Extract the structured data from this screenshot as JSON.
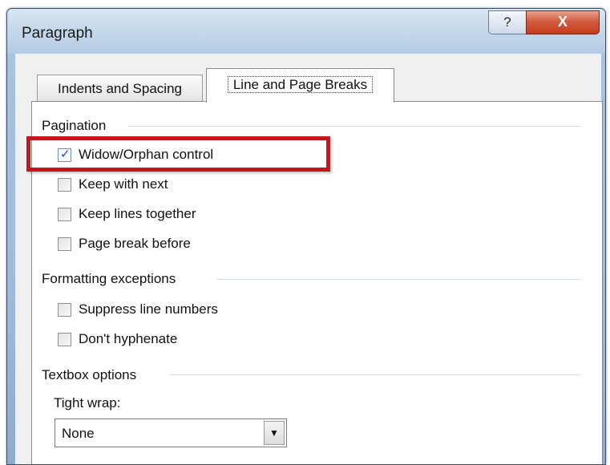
{
  "window": {
    "title": "Paragraph",
    "help_label": "?",
    "close_label": "X"
  },
  "tabs": [
    {
      "label": "Indents and Spacing",
      "active": false
    },
    {
      "label": "Line and Page Breaks",
      "active": true
    }
  ],
  "pagination": {
    "heading": "Pagination",
    "options": [
      {
        "label": "Widow/Orphan control",
        "checked": true
      },
      {
        "label": "Keep with next",
        "checked": false
      },
      {
        "label": "Keep lines together",
        "checked": false
      },
      {
        "label": "Page break before",
        "checked": false
      }
    ]
  },
  "formatting": {
    "heading": "Formatting exceptions",
    "options": [
      {
        "label": "Suppress line numbers",
        "checked": false
      },
      {
        "label": "Don't hyphenate",
        "checked": false
      }
    ]
  },
  "textbox": {
    "heading": "Textbox options",
    "tight_wrap_label": "Tight wrap:",
    "tight_wrap_value": "None"
  },
  "colors": {
    "highlight": "#c4161c",
    "close_button": "#c63c1d"
  }
}
